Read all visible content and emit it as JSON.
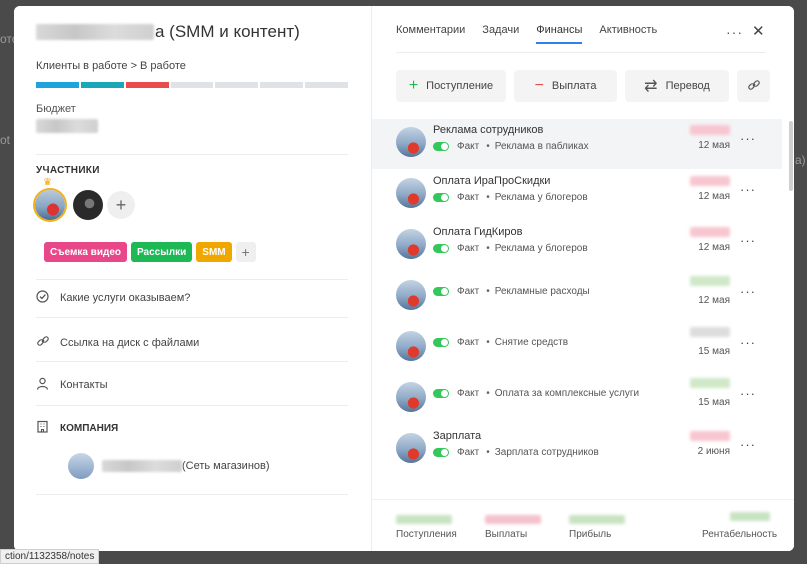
{
  "background": {
    "frag_left_top": "ото",
    "frag_left_mid": "ot",
    "frag_right": "а)"
  },
  "left": {
    "title_suffix": "а (SMM и контент)",
    "breadcrumb": "Клиенты в работе > В работе",
    "pipeline_colors": [
      "#1ea3dc",
      "#1aa7b6",
      "#e84c4c",
      "#dfe3e8",
      "#dfe3e8",
      "#dfe3e8",
      "#dfe3e8"
    ],
    "budget_label": "Бюджет",
    "participants_label": "УЧАСТНИКИ",
    "crown_icon": "♛",
    "add_icon": "+",
    "tags": [
      {
        "label": "Съемка видео",
        "color": "#e8488a"
      },
      {
        "label": "Рассылки",
        "color": "#1db954"
      },
      {
        "label": "SMM",
        "color": "#f0a800"
      }
    ],
    "tag_add": "+",
    "links": [
      {
        "label": "Какие услуги оказываем?",
        "icon": "check-circle-icon"
      },
      {
        "label": "Ссылка на диск с файлами",
        "icon": "link-icon"
      },
      {
        "label": "Контакты",
        "icon": "user-icon"
      }
    ],
    "company_label": "КОМПАНИЯ",
    "company_suffix": "(Сеть магазинов)"
  },
  "right": {
    "tabs": [
      "Комментарии",
      "Задачи",
      "Финансы",
      "Активность"
    ],
    "active_tab": "Финансы",
    "menu_icon": "···",
    "close_icon": "✕",
    "actions": {
      "income": "Поступление",
      "payout": "Выплата",
      "transfer": "Перевод"
    },
    "rows": [
      {
        "name": "Реклама сотрудников",
        "status": "Факт",
        "category": "Реклама в пабликах",
        "date": "12 мая",
        "amount_color": "#f7c6d0"
      },
      {
        "name": "Оплата ИраПроСкидки",
        "status": "Факт",
        "category": "Реклама у блогеров",
        "date": "12 мая",
        "amount_color": "#f7c6d0"
      },
      {
        "name": "Оплата ГидКиров",
        "status": "Факт",
        "category": "Реклама у блогеров",
        "date": "12 мая",
        "amount_color": "#f7c6d0"
      },
      {
        "name": "",
        "status": "Факт",
        "category": "Рекламные расходы",
        "date": "12 мая",
        "amount_color": "#cfe8c8"
      },
      {
        "name": "",
        "status": "Факт",
        "category": "Снятие средств",
        "date": "15 мая",
        "amount_color": "#dddddd"
      },
      {
        "name": "",
        "status": "Факт",
        "category": "Оплата за комплексные услуги",
        "date": "15 мая",
        "amount_color": "#cfe8c8"
      },
      {
        "name": "Зарплата",
        "status": "Факт",
        "category": "Зарплата сотрудников",
        "date": "2 июня",
        "amount_color": "#f7c6d0"
      }
    ],
    "footer": {
      "income": "Поступления",
      "payouts": "Выплаты",
      "profit": "Прибыль",
      "profitability": "Рентабельность"
    }
  },
  "statusbar": {
    "url": "ction/1132358/notes"
  }
}
